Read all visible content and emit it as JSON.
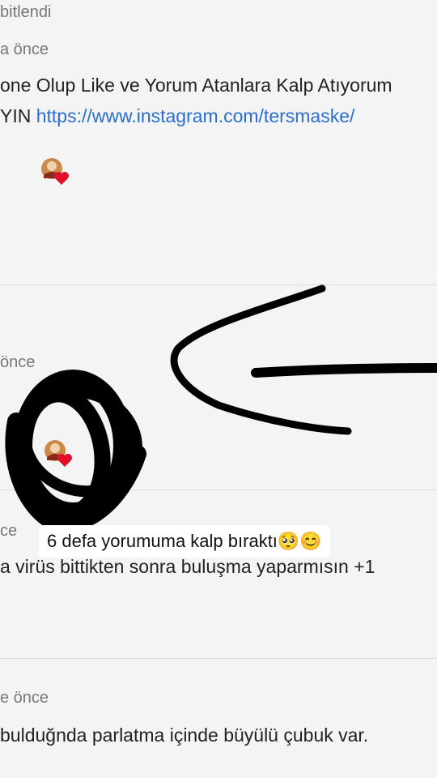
{
  "comment1": {
    "pinned_label": "bitlendi",
    "time_label": "a önce",
    "text_line1": "one Olup Like ve Yorum Atanlara Kalp Atıyorum",
    "text_line2_prefix": "YIN",
    "link": "https://www.instagram.com/tersmaske/"
  },
  "comment2": {
    "time_label": "önce"
  },
  "comment3": {
    "time_label": "ce",
    "text": "a virüs bittikten sonra buluşma yaparmısın +1"
  },
  "comment4": {
    "time_label": "e önce",
    "text": "bulduğnda parlatma içinde büyülü çubuk var."
  },
  "overlay": {
    "caption": "6 defa yorumuma kalp bıraktı🥺😊"
  },
  "colors": {
    "link": "#2a6fd0",
    "heart": "#e0102a",
    "marker": "#000000"
  }
}
